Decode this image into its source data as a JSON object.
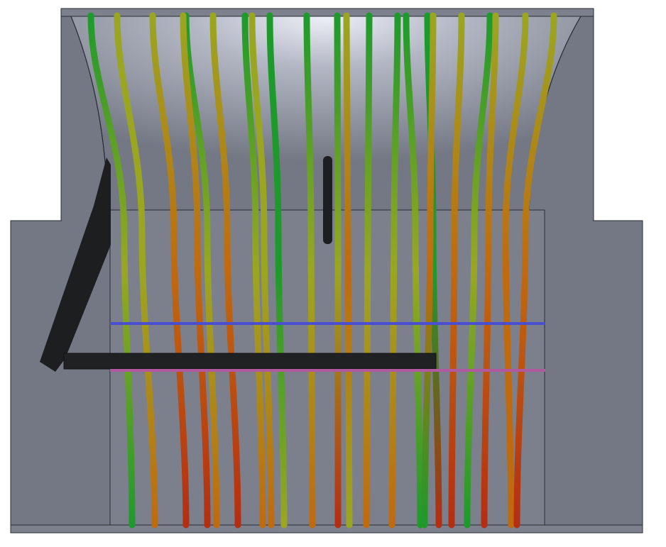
{
  "scene": {
    "background": "#ffffff",
    "body_color": "#737884",
    "body_dark": "#676b76",
    "edge_color": "#2a2d33",
    "inner_color": "#7b808c",
    "highlight_color": "#e8eaf2",
    "baffle_color": "#1d1e20",
    "section_lines": [
      {
        "name": "blue-section-line",
        "color": "#4a4fd0"
      },
      {
        "name": "magenta-section-line",
        "color": "#b2589f"
      }
    ]
  },
  "streamlines": {
    "colors": [
      "#1e9a2c",
      "#9aa622",
      "#c06a10",
      "#b42e12"
    ],
    "count": 22
  }
}
